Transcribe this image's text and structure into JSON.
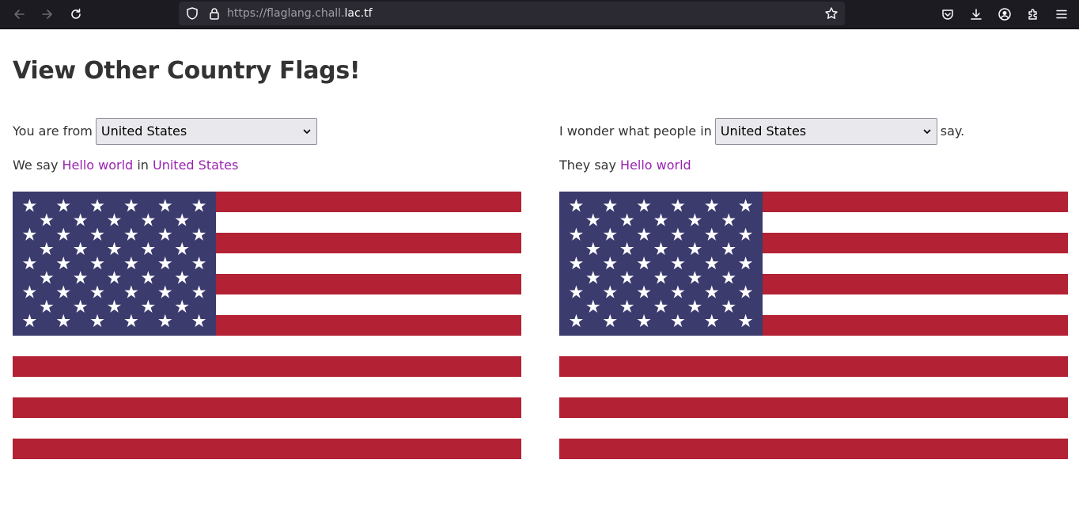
{
  "browser": {
    "url_prefix": "https://flaglang.chall.",
    "url_host": "lac.tf"
  },
  "page": {
    "title": "View Other Country Flags!"
  },
  "left": {
    "prefix": "You are from",
    "select_value": "United States",
    "say_prefix": "We say",
    "greeting": "Hello world",
    "in_word": "in",
    "country": "United States"
  },
  "right": {
    "prefix": "I wonder what people in",
    "select_value": "United States",
    "suffix": "say.",
    "say_prefix": "They say",
    "greeting": "Hello world"
  },
  "flag": {
    "name": "United States flag",
    "stripe_red": "#b22234",
    "stripe_white": "#ffffff",
    "canton_blue": "#3c3b6e"
  },
  "colors": {
    "link": "#9a22b0",
    "toolbar": "#1c1b22",
    "urlbar": "#2b2a33"
  }
}
